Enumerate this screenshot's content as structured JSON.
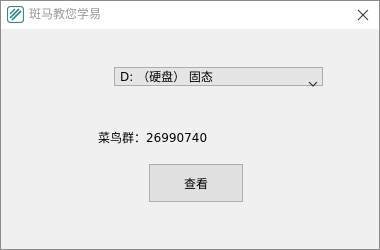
{
  "window": {
    "title": "斑马教您学易",
    "icon": "app-logo-icon",
    "close_icon": "close-icon",
    "accent_color": "#3a8a8c"
  },
  "drive_select": {
    "selected": "D: （硬盘） 固态",
    "icon": "chevron-down-icon"
  },
  "group_label": "菜鸟群：26990740",
  "view_button": {
    "label": "查看"
  }
}
